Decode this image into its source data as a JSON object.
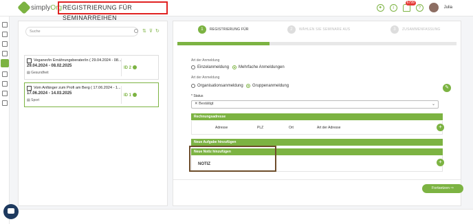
{
  "header": {
    "logo_prefix": "simply",
    "logo_suffix": "Org",
    "page_title": "REGISTRIERUNG FÜR SEMINARREIHEN",
    "notification_count": "6799",
    "username": "Julia"
  },
  "left": {
    "search_placeholder": "Suche",
    "courses": [
      {
        "title": "Veganer/in Ernährungsberater/in ( 29.04.2024 - 08...",
        "dates": "29.04.2024 - 08.02.2025",
        "category": "Gesundheit",
        "id": "ID 2"
      },
      {
        "title": "Vom Anfänger zum Profi am Berg ( 17.06.2024 - 1...",
        "dates": "17.06.2024 - 14.03.2025",
        "category": "Sport",
        "id": "ID 1"
      }
    ]
  },
  "steps": [
    {
      "num": "1",
      "label": "REGISTRIERUNG FÜR"
    },
    {
      "num": "2",
      "label": "WÄHLEN SIE SEMINARE AUS"
    },
    {
      "num": "3",
      "label": "ZUSAMMENFASSUNG"
    }
  ],
  "progress": 0.33,
  "form": {
    "reg_type_label": "Art der Anmeldung",
    "reg_single": "Einzelanmeldung",
    "reg_multi": "Mehrfache Anmeldungen",
    "reg_type_label2": "Art der Anmeldung",
    "reg_org": "Organisationsanmeldung",
    "reg_group": "Gruppenanmeldung",
    "status_label": "* Status",
    "status_value": "Bestätigt",
    "billing_title": "Rechnungsadresse",
    "columns": [
      "Adresse",
      "PLZ",
      "Ort",
      "Art der Adresse"
    ],
    "task_title": "Neue Aufgabe hinzufügen",
    "note_title": "Neue Notiz hinzufügen",
    "note_label": "NOTIZ",
    "continue_label": "Fortsetzen"
  },
  "colors": {
    "accent": "#7cb342",
    "highlight": "#e02020"
  }
}
